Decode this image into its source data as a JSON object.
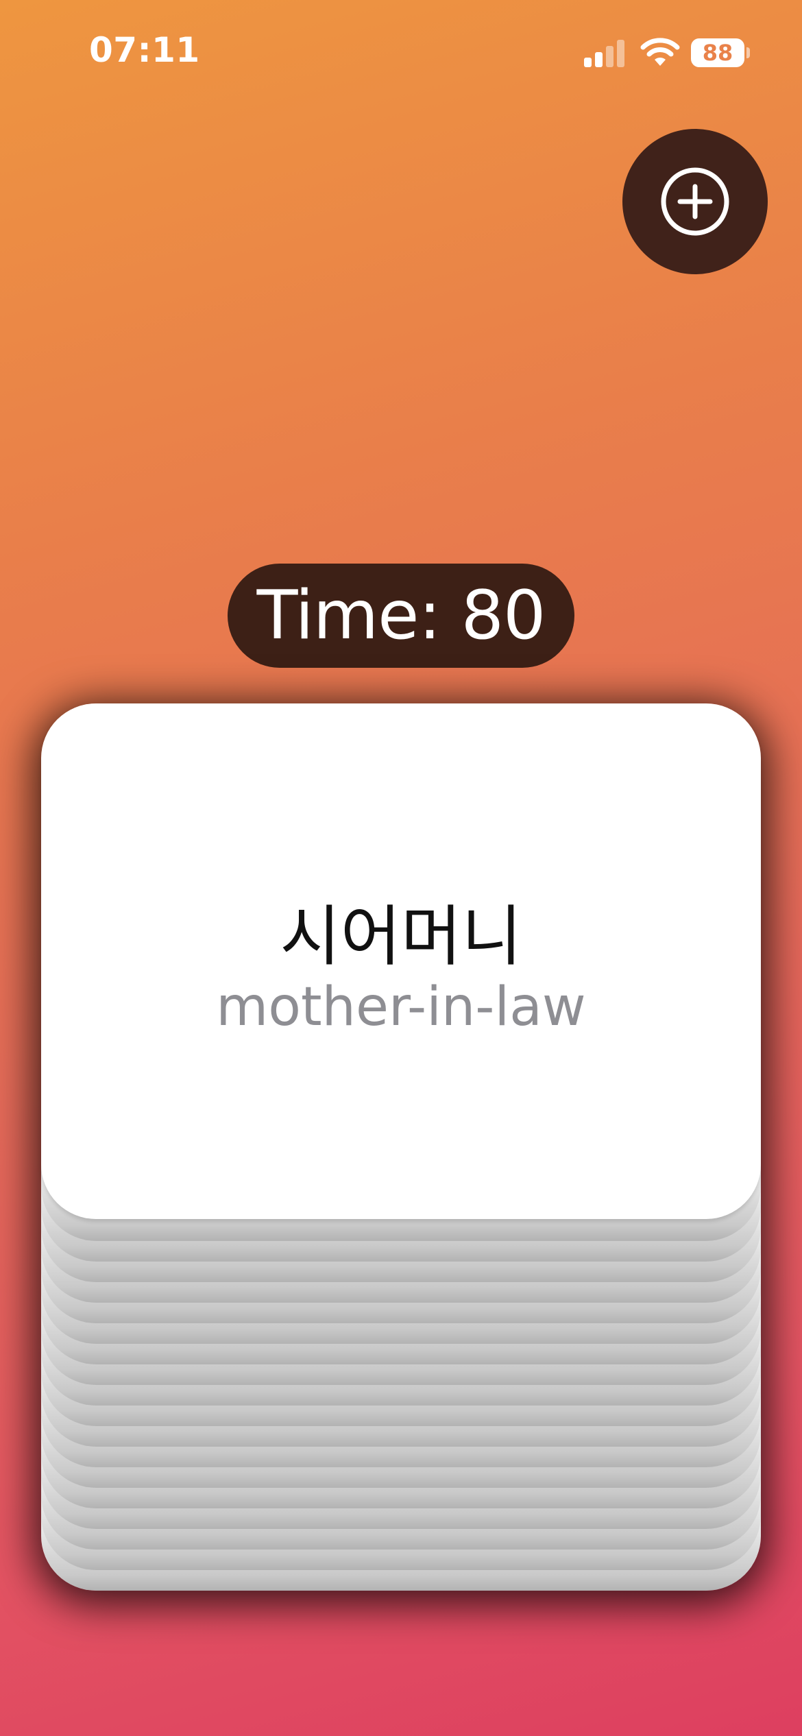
{
  "status_bar": {
    "time": "07:11",
    "battery_level": "88",
    "icons": [
      "signal-icon",
      "wifi-icon",
      "battery-icon"
    ]
  },
  "add_button": {
    "icon": "plus-circle-icon"
  },
  "timer": {
    "text": "Time: 80"
  },
  "card": {
    "word": "시어머니",
    "translation": "mother-in-law"
  },
  "colors": {
    "background_top": "#ee9640",
    "background_bottom": "#dd3f60",
    "dark_brown": "#3d2016",
    "card": "#ffffff",
    "translation_text": "#8e8e93"
  }
}
